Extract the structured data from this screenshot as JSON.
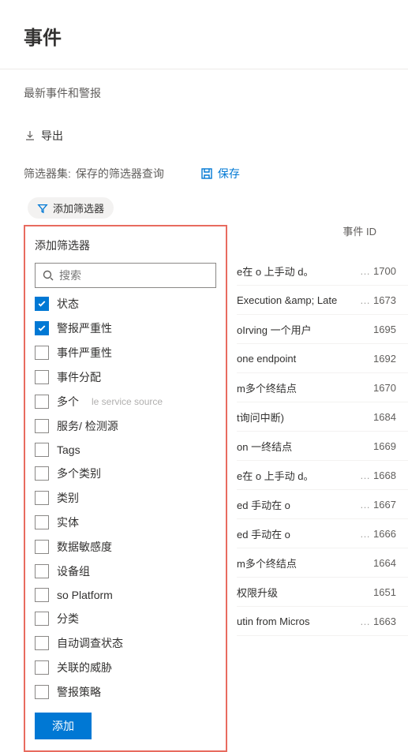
{
  "page": {
    "title": "事件",
    "subtitle": "最新事件和警报"
  },
  "toolbar": {
    "export_label": "导出"
  },
  "filterset": {
    "label": "筛选器集:",
    "query": "保存的筛选器查询",
    "save_label": "保存"
  },
  "addfilter_chip": "添加筛选器",
  "col_header_id": "事件 ID",
  "popup": {
    "title": "添加筛选器",
    "search_placeholder": "搜索",
    "add_button": "添加",
    "items": [
      {
        "label": "状态",
        "checked": true
      },
      {
        "label": "警报严重性",
        "checked": true
      },
      {
        "label": "事件严重性",
        "checked": false
      },
      {
        "label": "事件分配",
        "checked": false
      },
      {
        "label": "多个",
        "checked": false,
        "extra": "le service source"
      },
      {
        "label": "服务/    检测源",
        "checked": false
      },
      {
        "label": "Tags",
        "checked": false
      },
      {
        "label": "多个类别",
        "checked": false
      },
      {
        "label": "类别",
        "checked": false
      },
      {
        "label": "实体",
        "checked": false
      },
      {
        "label": "数据敏感度",
        "checked": false
      },
      {
        "label": "设备组",
        "checked": false
      },
      {
        "label": "so Platform",
        "checked": false
      },
      {
        "label": "分类",
        "checked": false
      },
      {
        "label": "自动调查状态",
        "checked": false
      },
      {
        "label": "关联的威胁",
        "checked": false
      },
      {
        "label": "警报策略",
        "checked": false
      }
    ]
  },
  "incidents": [
    {
      "name": "e在 o 上手动 d。",
      "id": "1700",
      "ell": true
    },
    {
      "name": "Execution &amp; Late",
      "id": "1673",
      "ell": true
    },
    {
      "name": "oIrving 一个用户",
      "id": "1695",
      "ell": false
    },
    {
      "name": "one endpoint",
      "id": "1692",
      "ell": false
    },
    {
      "name": "m多个终结点",
      "id": "1670",
      "ell": false
    },
    {
      "name": "t询问中断)",
      "id": "1684",
      "ell": false
    },
    {
      "name": "on 一终结点",
      "id": "1669",
      "ell": false
    },
    {
      "name": "e在 o 上手动 d。",
      "id": "1668",
      "ell": true
    },
    {
      "name": "ed 手动在 o",
      "id": "1667",
      "ell": true
    },
    {
      "name": "ed 手动在 o",
      "id": "1666",
      "ell": true
    },
    {
      "name": "m多个终结点",
      "id": "1664",
      "ell": false
    },
    {
      "name": "权限升级",
      "id": "1651",
      "ell": false
    },
    {
      "name": "utin from Micros",
      "id": "1663",
      "ell": true
    }
  ]
}
